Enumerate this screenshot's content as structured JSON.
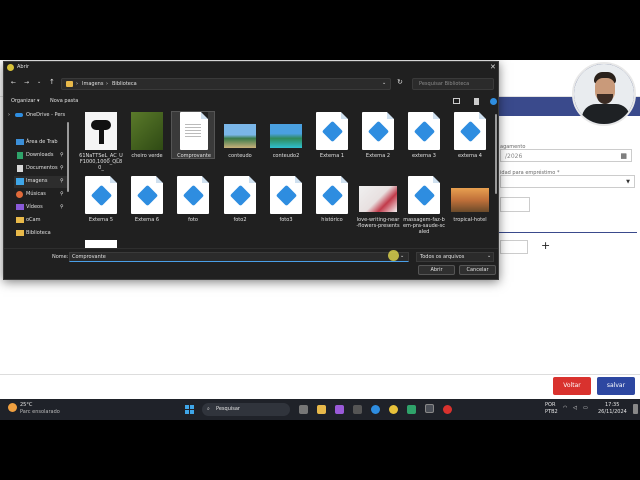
{
  "dialog": {
    "title": "Abrir",
    "breadcrumb": [
      "Imagens",
      "Biblioteca"
    ],
    "search_placeholder": "Pesquisar Biblioteca",
    "organize_label": "Organizar",
    "new_folder_label": "Nova pasta",
    "nav_items": [
      {
        "label": "OneDrive - Pers"
      },
      {
        "label": "Área de Trab"
      },
      {
        "label": "Downloads"
      },
      {
        "label": "Documentos"
      },
      {
        "label": "Imagens"
      },
      {
        "label": "Músicas"
      },
      {
        "label": "Vídeos"
      },
      {
        "label": "oCam"
      },
      {
        "label": "Biblioteca"
      }
    ],
    "files_row1": [
      {
        "label": "61NaTTSeL_AC_UF1000,1000_QL80_",
        "kind": "photo-hairdryer"
      },
      {
        "label": "cheiro verde",
        "kind": "photo-herb"
      },
      {
        "label": "Comprovante",
        "kind": "doc"
      },
      {
        "label": "conteudo",
        "kind": "photo-beach"
      },
      {
        "label": "conteudo2",
        "kind": "photo-beach2"
      },
      {
        "label": "Externa 1",
        "kind": "img-icon"
      },
      {
        "label": "Externa 2",
        "kind": "img-icon"
      },
      {
        "label": "externa 3",
        "kind": "img-icon"
      },
      {
        "label": "externa 4",
        "kind": "img-icon"
      }
    ],
    "files_row2": [
      {
        "label": "Externa 5",
        "kind": "img-icon"
      },
      {
        "label": "Externa 6",
        "kind": "img-icon"
      },
      {
        "label": "foto",
        "kind": "img-icon"
      },
      {
        "label": "foto2",
        "kind": "img-icon"
      },
      {
        "label": "foto3",
        "kind": "img-icon"
      },
      {
        "label": "histórico",
        "kind": "img-icon"
      },
      {
        "label": "love-writing-near-flowers-presents",
        "kind": "photo-flowers"
      },
      {
        "label": "massagem-faz-bem-pra-saude-scaled",
        "kind": "img-icon"
      },
      {
        "label": "tropical-hotel",
        "kind": "photo-hotel"
      }
    ],
    "name_label": "Nome:",
    "name_value": "Comprovante",
    "file_type_value": "Todos os arquivos",
    "open_button": "Abrir",
    "cancel_button": "Cancelar"
  },
  "app": {
    "field1_label": "agamento",
    "field1_value": "/2026",
    "field2_label": "idad para empréstimo *",
    "voltar_label": "Voltar",
    "salvar_label": "salvar",
    "header_color": "#3a4a8c"
  },
  "taskbar": {
    "weather_temp": "25°C",
    "weather_desc": "Parc ensolarado",
    "search_label": "Pesquisar",
    "lang_line1": "POR",
    "lang_line2": "PTB2",
    "time": "17:35",
    "date": "26/11/2024"
  }
}
